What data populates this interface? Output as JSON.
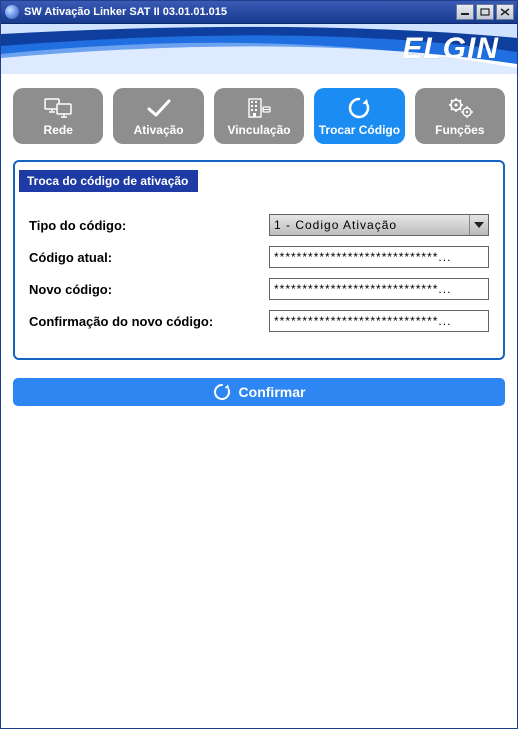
{
  "window": {
    "title": "SW Ativação Linker SAT II 03.01.01.015"
  },
  "brand": "ELGIN",
  "nav": {
    "items": [
      {
        "label": "Rede",
        "icon": "monitors-icon",
        "active": false
      },
      {
        "label": "Ativação",
        "icon": "check-icon",
        "active": false
      },
      {
        "label": "Vinculação",
        "icon": "building-icon",
        "active": false
      },
      {
        "label": "Trocar Código",
        "icon": "refresh-icon",
        "active": true
      },
      {
        "label": "Funções",
        "icon": "gears-icon",
        "active": false
      }
    ]
  },
  "panel": {
    "title": "Troca do código de ativação",
    "labels": {
      "tipo": "Tipo do código:",
      "atual": "Código atual:",
      "novo": "Novo código:",
      "confirmacao": "Confirmação do novo código:"
    },
    "select": {
      "value": "1 - Codigo Ativação"
    },
    "fields": {
      "atual_value": "*****************************...",
      "novo_value": "*****************************...",
      "conf_value": "*****************************..."
    }
  },
  "confirm_label": "Confirmar"
}
